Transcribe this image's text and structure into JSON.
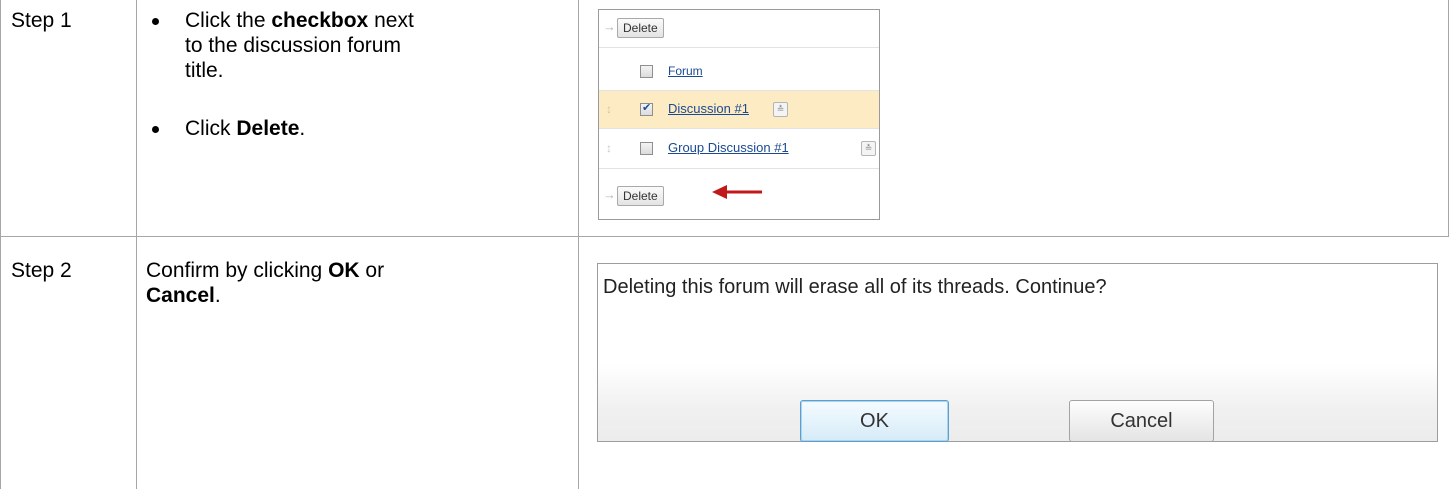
{
  "steps": [
    {
      "label": "Step 1",
      "bullets": [
        {
          "pre": "Click the ",
          "bold": "checkbox",
          "post": " next to the discussion forum title."
        },
        {
          "pre": "Click ",
          "bold": "Delete",
          "post": "."
        }
      ]
    },
    {
      "label": "Step 2",
      "text": {
        "pre": "Confirm by clicking ",
        "bold1": "OK",
        "mid": " or ",
        "bold2": "Cancel",
        "post": "."
      }
    }
  ],
  "forum_panel": {
    "top_button": "Delete",
    "header_label": "Forum",
    "rows": [
      {
        "title": "Discussion #1",
        "checked": true,
        "highlight": "#fdebc4"
      },
      {
        "title": "Group Discussion #1",
        "checked": false,
        "highlight": "#ffffff"
      }
    ],
    "bottom_button": "Delete",
    "pointer_color": "#c0191a"
  },
  "dialog": {
    "message": "Deleting this forum will erase all of its threads. Continue?",
    "ok_label": "OK",
    "cancel_label": "Cancel"
  }
}
